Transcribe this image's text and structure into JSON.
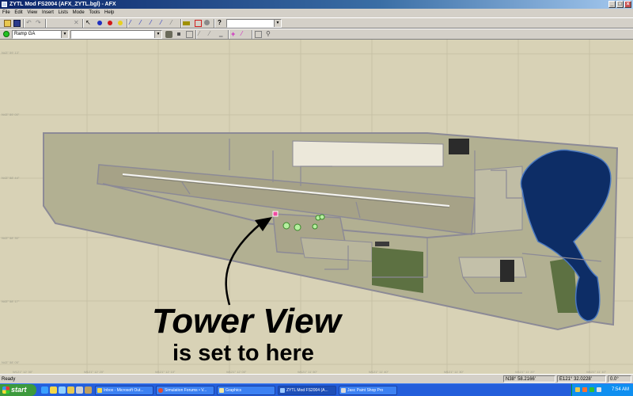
{
  "window": {
    "title": "ZYTL Mod FS2004 (AFX_ZYTL.bgl) - AFX",
    "controls": [
      "_",
      "□",
      "×"
    ]
  },
  "menu": [
    "File",
    "Edit",
    "View",
    "Insert",
    "Lists",
    "Mode",
    "Tools",
    "Help"
  ],
  "toolbar": {
    "combo_empty": ""
  },
  "toolbar2": {
    "ramp_select": "Ramp GA",
    "name_select": ""
  },
  "map": {
    "colors": {
      "grass": "#b2b092",
      "apron": "#a6a287",
      "taxi": "#8c8a96",
      "water": "#0d2d66",
      "forest": "#5d7142",
      "dark": "#2b2b2b",
      "bg": "#d8d2b6"
    },
    "lat_labels": [
      "N43° 59' 13\"",
      "N43° 59' 00\"",
      "N43° 58' 44\"",
      "N43° 58' 30\"",
      "N43° 58' 17\"",
      "N43° 58' 05\""
    ],
    "lon_labels": [
      "W121° 12' 30\"",
      "W121° 12' 20\"",
      "W121° 12' 10\"",
      "W121° 12' 00\"",
      "W121° 11' 50\"",
      "W121° 11' 40\"",
      "W121° 11' 30\"",
      "W121° 11' 20\"",
      "W121° 11' 10\""
    ]
  },
  "annotation": {
    "title": "Tower View",
    "subtitle": "is set to here"
  },
  "status": {
    "ready": "Ready",
    "lat": "N38° 58.2166'",
    "lon": "E121° 32.0228'",
    "heading": "0.0°"
  },
  "taskbar": {
    "start": "start",
    "tasks": [
      {
        "label": "Inbox - Microsoft Out...",
        "color": "#f5d84a"
      },
      {
        "label": "Simulation Forums • V...",
        "color": "#e34b32"
      },
      {
        "label": "Graphics",
        "color": "#f0e6a0"
      },
      {
        "label": "ZYTL Mod FS2004 (A...",
        "color": "#9ac7ff"
      },
      {
        "label": "Jasc Paint Shop Pro",
        "color": "#d9d9d9"
      }
    ],
    "clock": "7:54 AM"
  }
}
